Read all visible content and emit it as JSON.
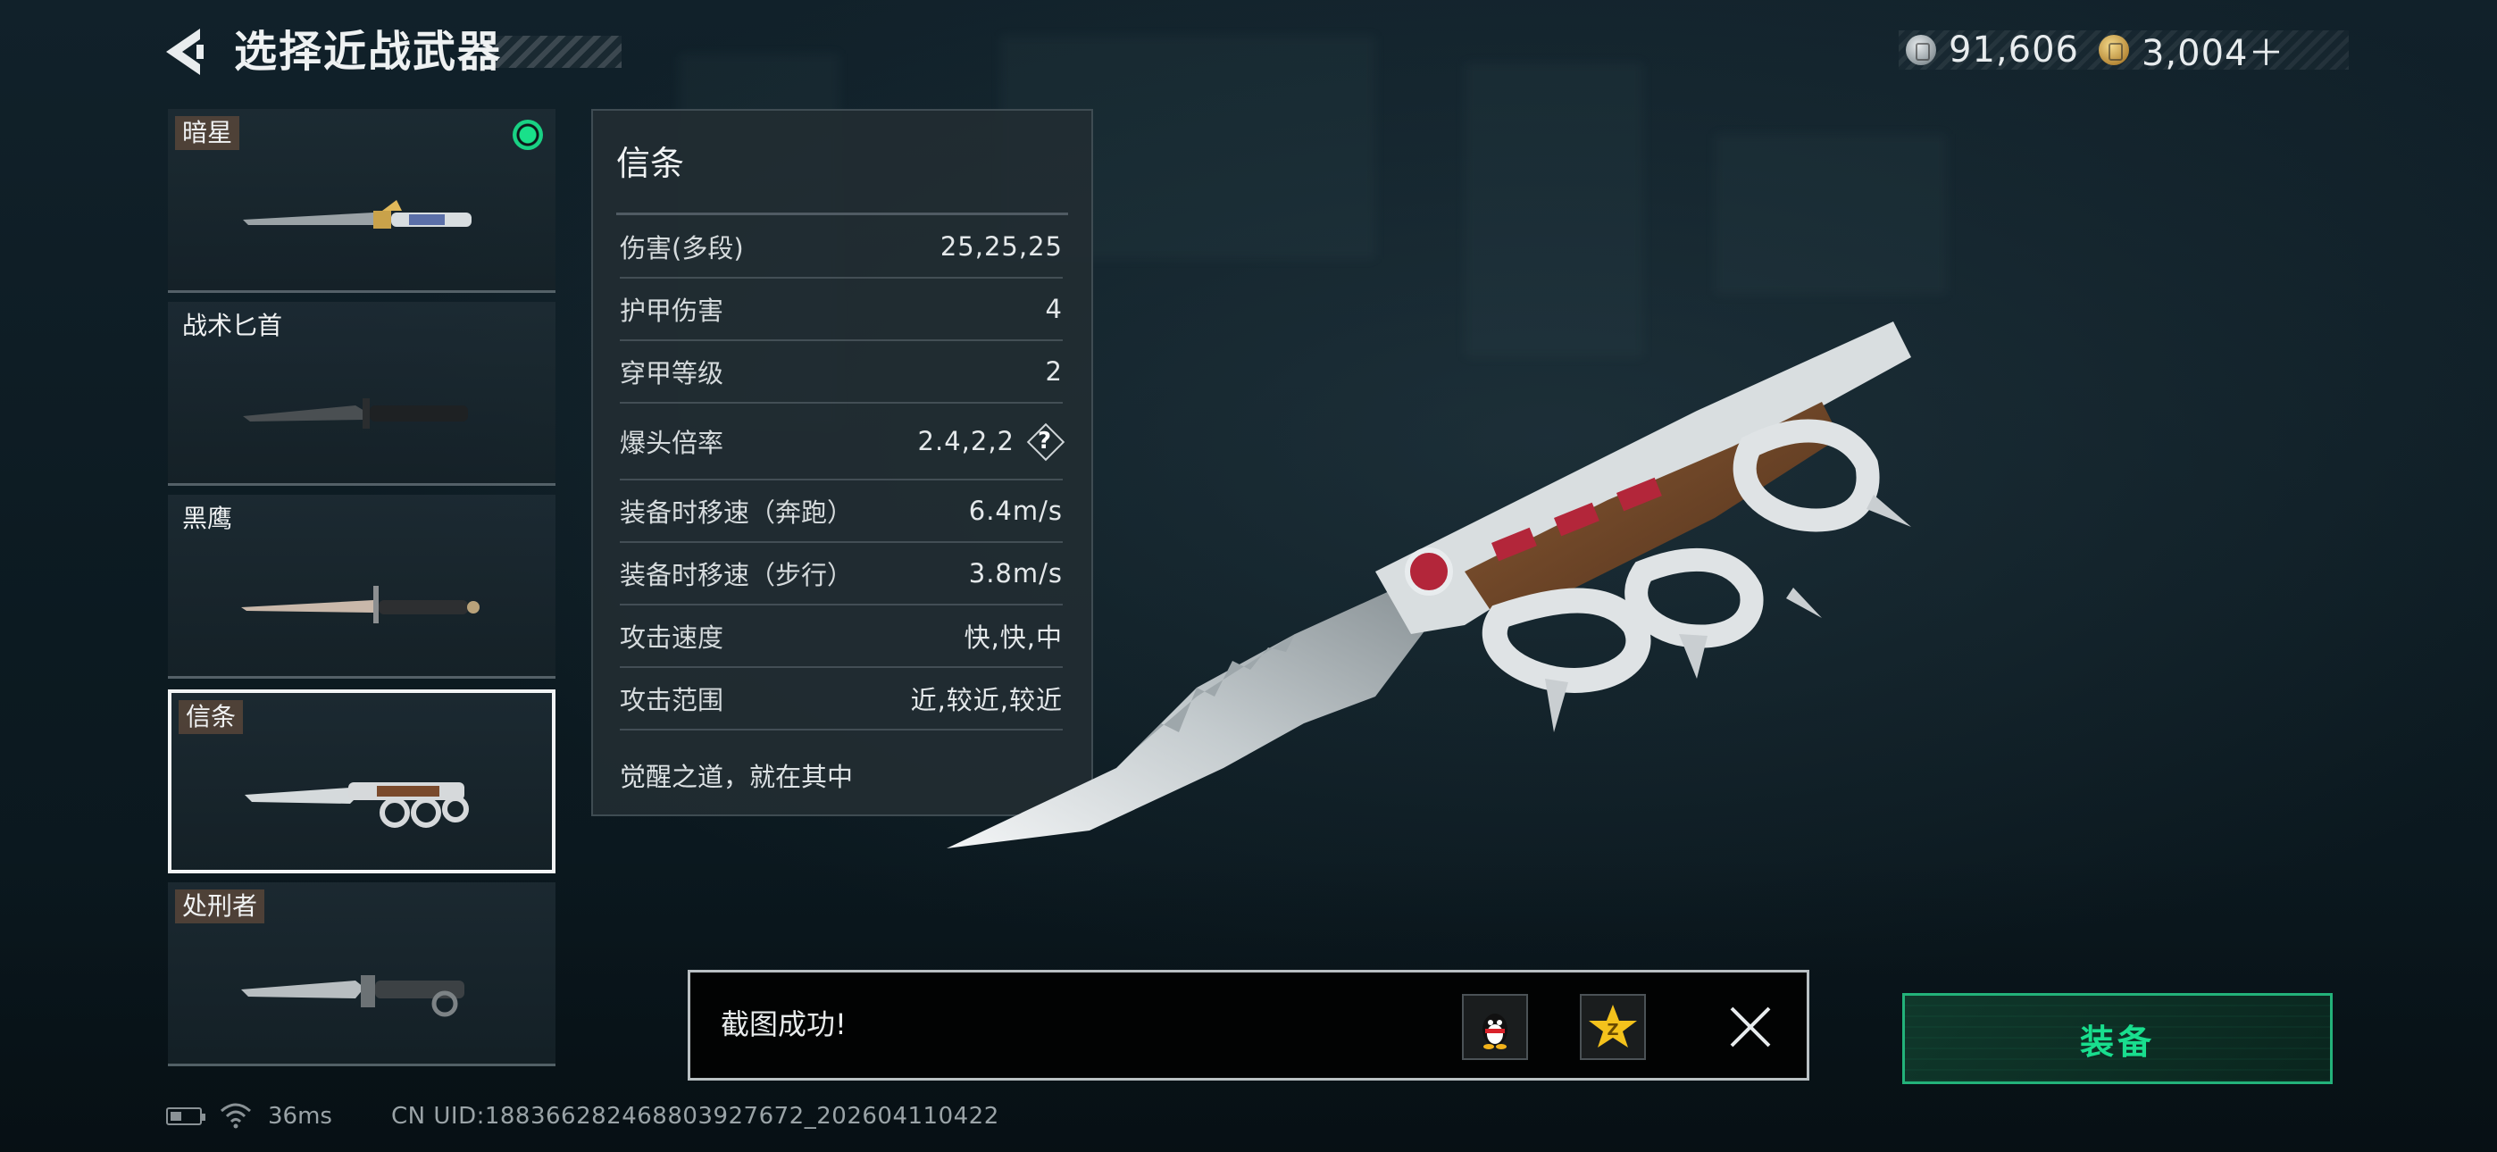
{
  "header": {
    "title": "选择近战武器",
    "currencies": [
      {
        "icon": "silver-coin-icon",
        "value": "91,606"
      },
      {
        "icon": "gold-coin-icon",
        "value": "3,004＋"
      }
    ]
  },
  "weapons": [
    {
      "name": "暗星",
      "equipped": true,
      "selected": false
    },
    {
      "name": "战术匕首",
      "equipped": false,
      "selected": false
    },
    {
      "name": "黑鹰",
      "equipped": false,
      "selected": false
    },
    {
      "name": "信条",
      "equipped": false,
      "selected": true
    },
    {
      "name": "处刑者",
      "equipped": false,
      "selected": false
    }
  ],
  "stats": {
    "title": "信条",
    "rows": [
      {
        "label": "伤害(多段)",
        "value": "25,25,25"
      },
      {
        "label": "护甲伤害",
        "value": "4"
      },
      {
        "label": "穿甲等级",
        "value": "2"
      },
      {
        "label": "爆头倍率",
        "value": "2.4,2,2",
        "help": "?"
      },
      {
        "label": "装备时移速（奔跑）",
        "value": "6.4m/s"
      },
      {
        "label": "装备时移速（步行）",
        "value": "3.8m/s"
      },
      {
        "label": "攻击速度",
        "value": "快,快,中"
      },
      {
        "label": "攻击范围",
        "value": "近,较近,较近"
      }
    ],
    "footer": "觉醒之道，就在其中"
  },
  "toast": {
    "message": "截图成功!",
    "share_targets": [
      "qq-penguin-icon",
      "qzone-star-icon"
    ],
    "close_icon": "close-icon"
  },
  "equip_button": {
    "label": "装备",
    "accent": "#19de8e"
  },
  "status_bar": {
    "ping": "36ms",
    "uid": "CN UID:18836628246880392767​2_202604110422"
  }
}
